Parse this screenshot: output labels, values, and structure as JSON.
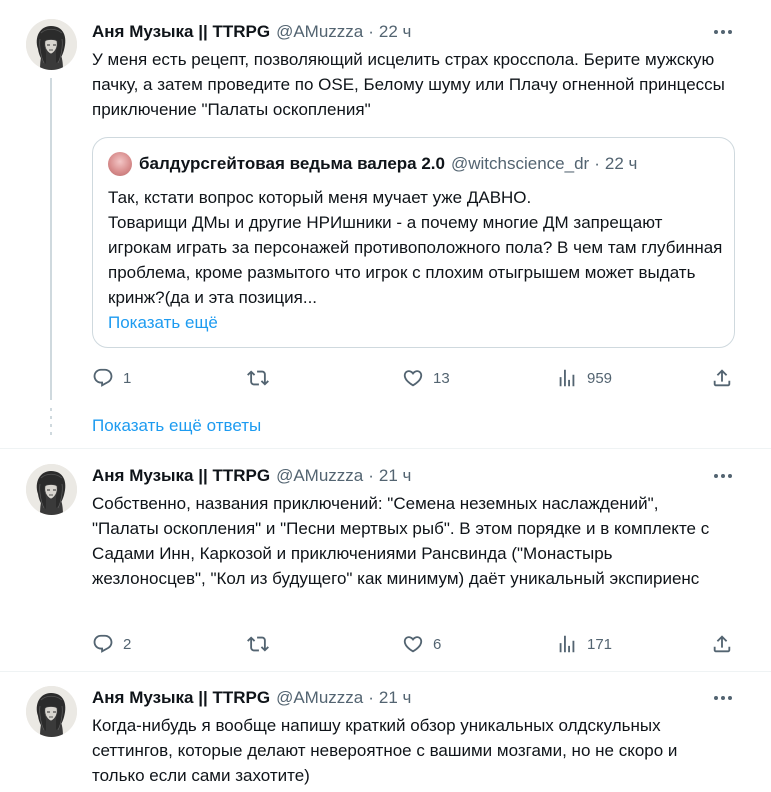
{
  "tweets": [
    {
      "name": "Аня Музыка || TTRPG",
      "handle": "@AMuzzza",
      "time": "22 ч",
      "text": "У меня есть рецепт, позволяющий исцелить страх кросспола. Берите мужскую пачку, а затем проведите по OSE, Белому шуму или Плачу огненной принцессы приключение \"Палаты оскопления\"",
      "quote": {
        "name": "балдурсгейтовая ведьма валера 2.0",
        "handle": "@witchscience_dr",
        "time": "22 ч",
        "text": "Так, кстати вопрос который меня мучает уже ДАВНО.\nТоварищи ДМы и другие НРИшники - а почему многие ДМ запрещают игрокам играть за персонажей противоположного пола? В чем там глубинная проблема, кроме размытого что игрок с плохим отыгрышем может выдать кринж?(да и эта позиция...",
        "show_more": "Показать ещё"
      },
      "replies": "1",
      "retweets": "",
      "likes": "13",
      "views": "959"
    },
    {
      "name": "Аня Музыка || TTRPG",
      "handle": "@AMuzzza",
      "time": "21 ч",
      "text": "Собственно, названия приключений: \"Семена неземных наслаждений\", \"Палаты оскопления\" и \"Песни мертвых рыб\". В этом порядке и в комплекте с Садами Инн, Каркозой и приключениями Рансвинда (\"Монастырь жезлоносцев\", \"Кол из будущего\" как минимум) даёт уникальный экспириенс",
      "replies": "2",
      "retweets": "",
      "likes": "6",
      "views": "171"
    },
    {
      "name": "Аня Музыка || TTRPG",
      "handle": "@AMuzzza",
      "time": "21 ч",
      "text": "Когда-нибудь я вообще напишу краткий обзор уникальных олдскульных сеттингов, которые делают невероятное с вашими мозгами, но не скоро и только если сами захотите)"
    }
  ],
  "show_more_replies": "Показать ещё ответы",
  "dot_separator": "·",
  "icons": {
    "reply": "reply-icon",
    "retweet": "retweet-icon",
    "like": "heart-icon",
    "views": "views-icon",
    "share": "share-icon",
    "more": "more-icon"
  },
  "colors": {
    "link": "#1d9bf0",
    "muted": "#536471",
    "text": "#0f1419",
    "border": "#cfd9de"
  }
}
